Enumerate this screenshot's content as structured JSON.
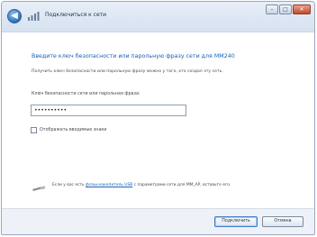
{
  "window": {
    "title": "Подключиться к сети",
    "controls": {
      "minimize": "–",
      "maximize": "□",
      "close": "✕"
    }
  },
  "icons": {
    "back": "back-arrow-icon",
    "network": "network-icon",
    "hint": "usb-key-icon"
  },
  "content": {
    "heading": "Введите ключ безопасности или парольную фразу сети для MM240",
    "description": "Получить ключ безопасности или парольную фразу можно у того, кто создал эту сеть.",
    "key_label": "Ключ безопасности сети или парольная фраза:",
    "key_value": "••••••••••",
    "show_chars_label": "Отображать вводимые знаки",
    "show_chars_checked": false,
    "hint_prefix": "Если у вас есть ",
    "hint_link": "флэш-накопитель USB",
    "hint_suffix": " с параметрами сети для MM_AP, вставьте его."
  },
  "footer": {
    "connect_label": "Подключить",
    "cancel_label": "Отмена"
  },
  "colors": {
    "accent": "#1a5fb4",
    "titlebar": "#dbe6f3"
  }
}
